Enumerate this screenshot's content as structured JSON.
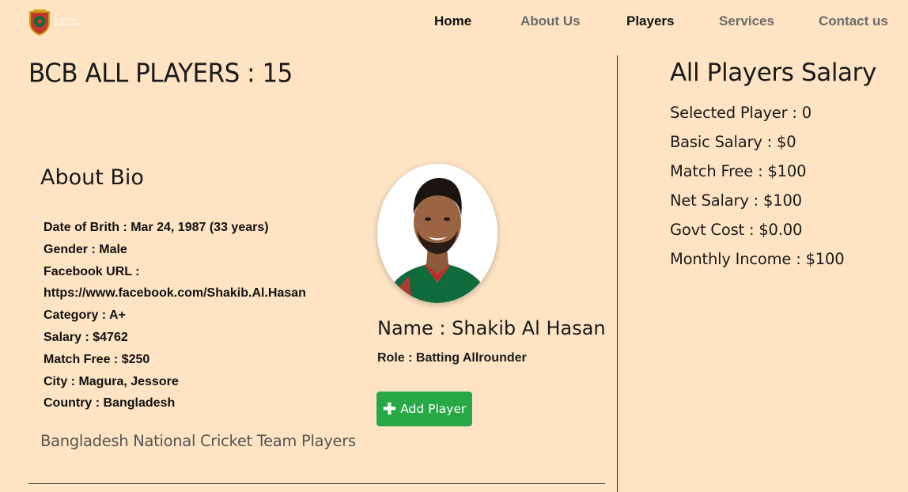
{
  "nav": {
    "logo_text": [
      "Bangladesh",
      "Cricket Board"
    ],
    "items": [
      {
        "label": "Home",
        "active": true
      },
      {
        "label": "About Us",
        "active": false
      },
      {
        "label": "Players",
        "active": true
      },
      {
        "label": "Services",
        "active": false
      },
      {
        "label": "Contact us",
        "active": false
      }
    ]
  },
  "main": {
    "title": "BCB ALL PLAYERS : 15",
    "about_heading": "About Bio",
    "bio": [
      "Date of Brith : Mar 24, 1987 (33 years)",
      "Gender : Male",
      "Facebook URL :",
      "https://www.facebook.com/Shakib.Al.Hasan",
      "Category : A+",
      "Salary : $4762",
      "Match Free : $250",
      "City : Magura, Jessore",
      "Country : Bangladesh"
    ],
    "caption": "Bangladesh National Cricket Team Players"
  },
  "player": {
    "name": "Name : Shakib Al Hasan",
    "role": "Role : Batting Allrounder",
    "add_button": "Add Player",
    "add_icon": "plus-icon"
  },
  "salary": {
    "title": "All Players Salary",
    "lines": [
      "Selected Player : 0",
      "Basic Salary : $0",
      "Match Free : $100",
      "Net Salary : $100",
      "Govt Cost : $0.00",
      "Monthly Income : $100"
    ]
  },
  "colors": {
    "background": "#ffe4c4",
    "button": "#28a745",
    "nav_inactive": "#6b6b6b"
  }
}
